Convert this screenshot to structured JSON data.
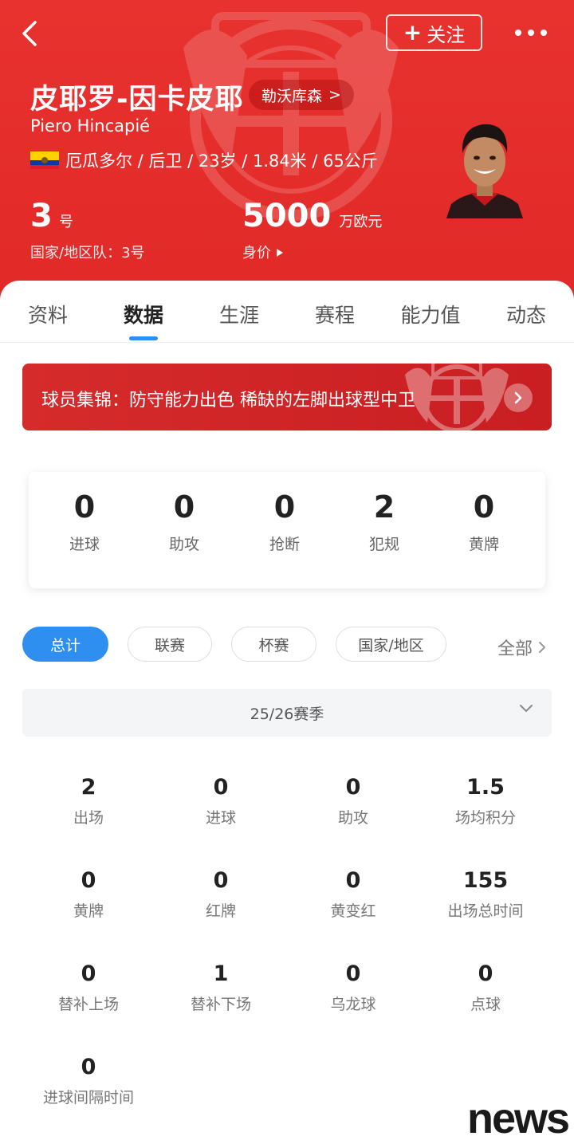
{
  "header": {
    "follow_label": "关注",
    "player_name": "皮耶罗-因卡皮耶",
    "club_label": "勒沃库森",
    "club_arrow": ">",
    "english_name": "Piero Hincapié",
    "info": "厄瓜多尔 / 后卫 / 23岁 / 1.84米 / 65公斤",
    "shirt_number": "3",
    "shirt_unit": "号",
    "national_team": "国家/地区队：3号",
    "market_value": "5000",
    "market_value_unit": "万欧元",
    "market_value_label": "身价",
    "bg_color": "#e12a28",
    "flag": "ecuador-flag"
  },
  "tabs": [
    "资料",
    "数据",
    "生涯",
    "赛程",
    "能力值",
    "动态"
  ],
  "active_tab": "数据",
  "banner": {
    "text": "球员集锦：防守能力出色 稀缺的左脚出球型中卫"
  },
  "summary": [
    {
      "value": "0",
      "label": "进球"
    },
    {
      "value": "0",
      "label": "助攻"
    },
    {
      "value": "0",
      "label": "抢断"
    },
    {
      "value": "2",
      "label": "犯规"
    },
    {
      "value": "0",
      "label": "黄牌"
    }
  ],
  "filters": {
    "chips": [
      "总计",
      "联赛",
      "杯赛",
      "国家/地区"
    ],
    "active": "总计",
    "all_label": "全部"
  },
  "season": "25/26赛季",
  "stats": [
    {
      "value": "2",
      "label": "出场"
    },
    {
      "value": "0",
      "label": "进球"
    },
    {
      "value": "0",
      "label": "助攻"
    },
    {
      "value": "1.5",
      "label": "场均积分"
    },
    {
      "value": "0",
      "label": "黄牌"
    },
    {
      "value": "0",
      "label": "红牌"
    },
    {
      "value": "0",
      "label": "黄变红"
    },
    {
      "value": "155",
      "label": "出场总时间"
    },
    {
      "value": "0",
      "label": "替补上场"
    },
    {
      "value": "1",
      "label": "替补下场"
    },
    {
      "value": "0",
      "label": "乌龙球"
    },
    {
      "value": "0",
      "label": "点球"
    },
    {
      "value": "0",
      "label": "进球间隔时间"
    }
  ],
  "watermark": "news",
  "accent_color": "#2e8ff0"
}
